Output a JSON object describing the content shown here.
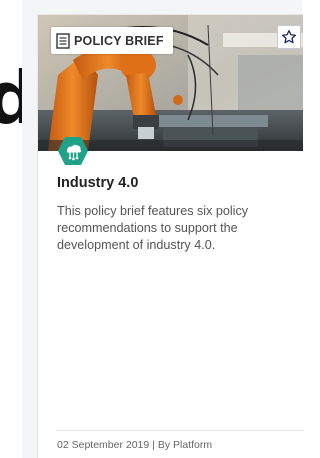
{
  "left_glyph": "d",
  "card": {
    "tag": {
      "icon": "document-icon",
      "label": "POLICY BRIEF"
    },
    "star_icon": "star-icon",
    "hero_image": "industrial-robot-arm-photo",
    "topic_icon": "cloud-network-icon",
    "title": "Industry 4.0",
    "description": "This policy brief features six policy recommendations to support the development of industry 4.0.",
    "date": "02 September 2019",
    "separator": "|",
    "author": "By Platform"
  },
  "colors": {
    "topic_badge": "#1fa28a",
    "robot_orange": "#e57a1f",
    "star_outline": "#1f2d5c"
  }
}
